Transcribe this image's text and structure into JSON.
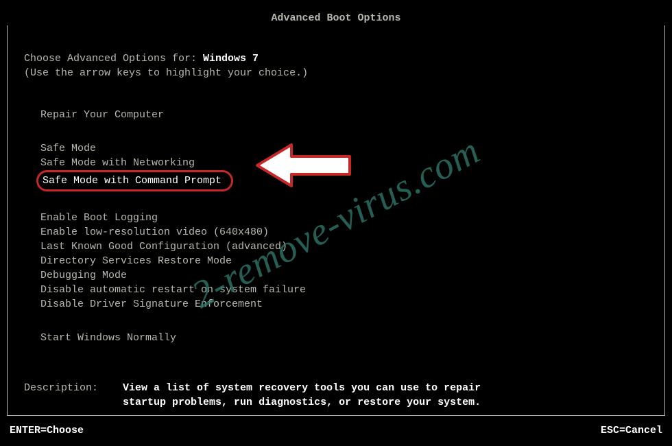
{
  "title": "Advanced Boot Options",
  "intro": {
    "prefix": "Choose Advanced Options for: ",
    "os": "Windows 7",
    "hint": "(Use the arrow keys to highlight your choice.)"
  },
  "groups": [
    {
      "items": [
        "Repair Your Computer"
      ]
    },
    {
      "items": [
        "Safe Mode",
        "Safe Mode with Networking",
        "Safe Mode with Command Prompt"
      ],
      "highlightedIndex": 2
    },
    {
      "items": [
        "Enable Boot Logging",
        "Enable low-resolution video (640x480)",
        "Last Known Good Configuration (advanced)",
        "Directory Services Restore Mode",
        "Debugging Mode",
        "Disable automatic restart on system failure",
        "Disable Driver Signature Enforcement"
      ]
    },
    {
      "items": [
        "Start Windows Normally"
      ]
    }
  ],
  "description": {
    "label": "Description:    ",
    "line1": "View a list of system recovery tools you can use to repair",
    "line2": "startup problems, run diagnostics, or restore your system."
  },
  "footer": {
    "left": "ENTER=Choose",
    "right": "ESC=Cancel"
  },
  "watermark": "2-remove-virus.com",
  "annotation": {
    "arrow_color_fill": "#ffffff",
    "arrow_color_stroke": "#c62828",
    "highlight_stroke": "#c62828"
  }
}
